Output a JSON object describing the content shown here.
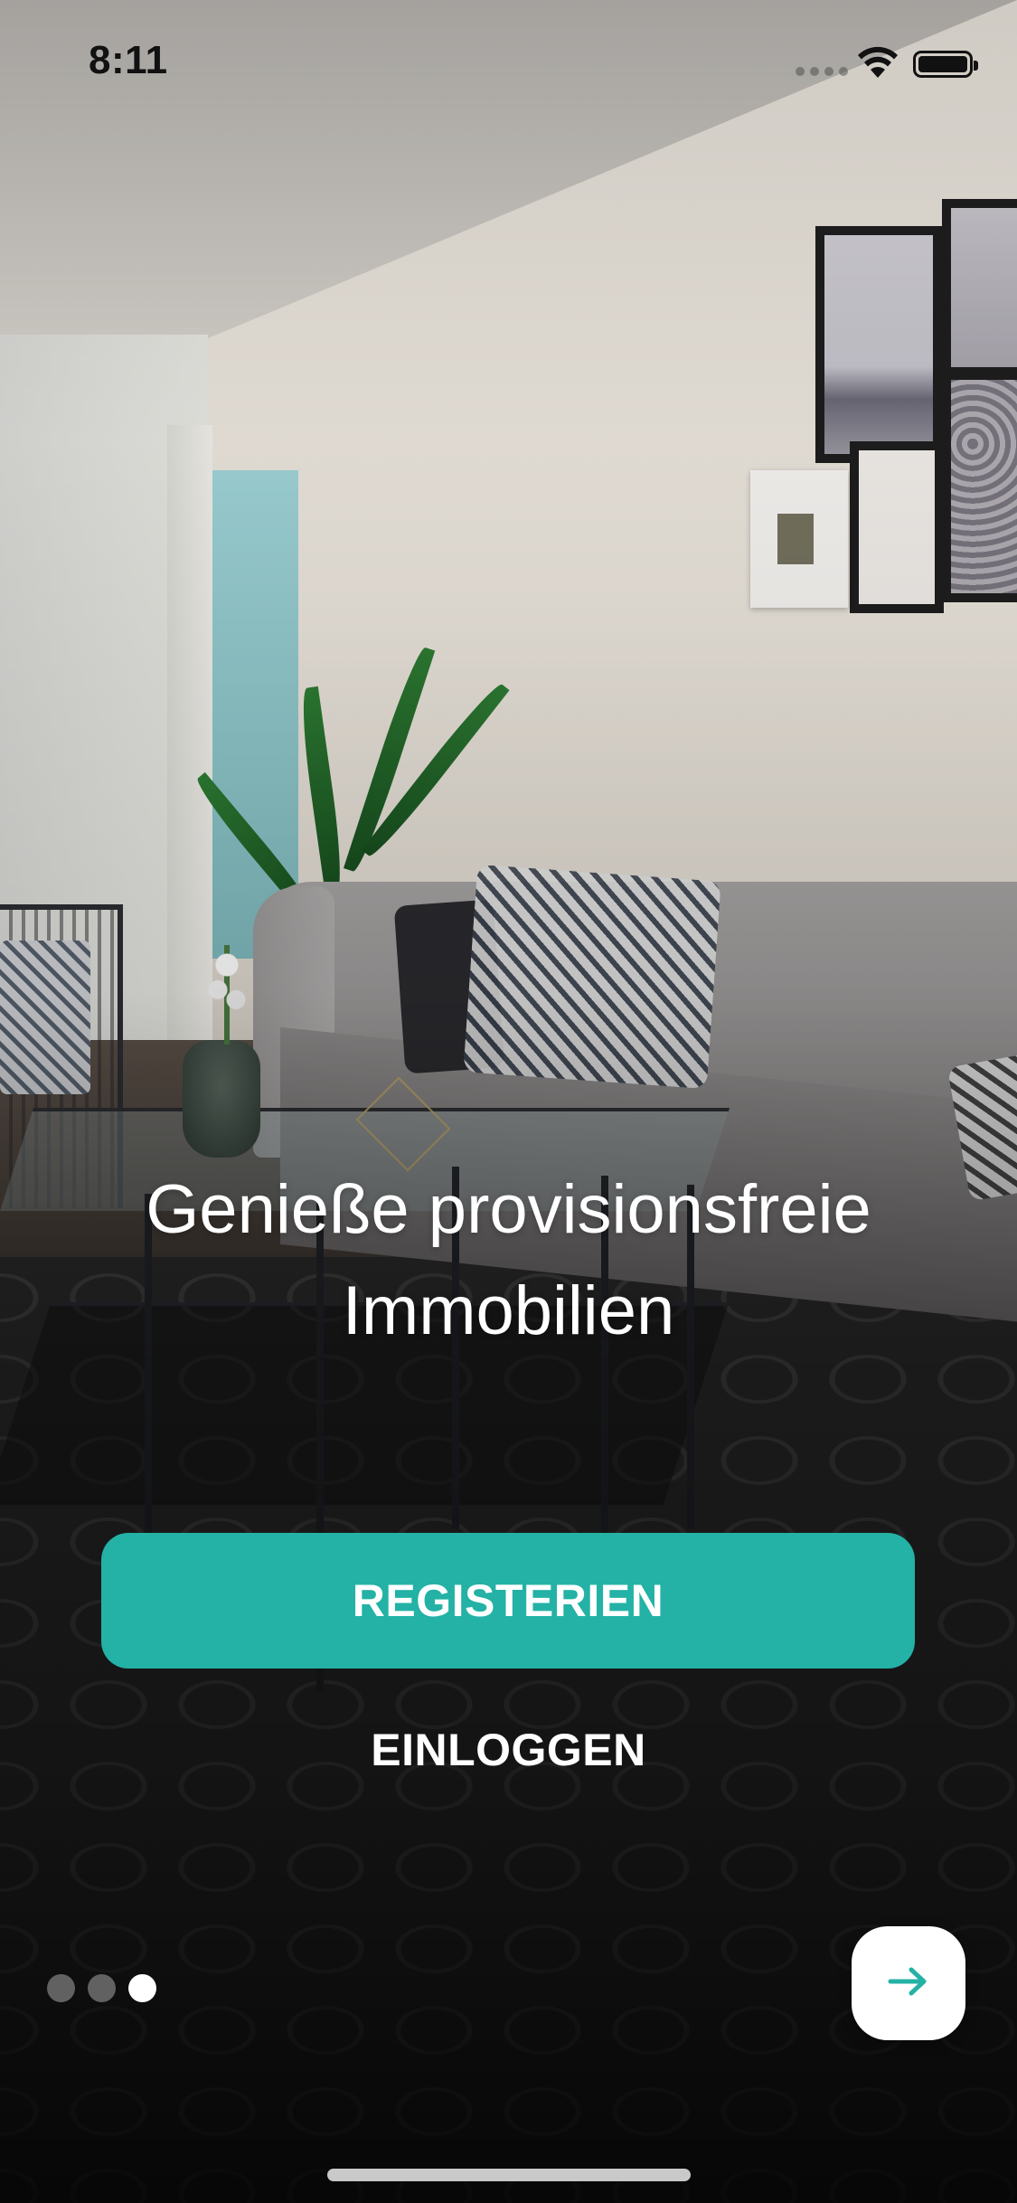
{
  "status_bar": {
    "time": "8:11"
  },
  "headline": {
    "line1": "Genieße provisionsfreie",
    "line2": "Immobilien"
  },
  "buttons": {
    "register_label": "REGISTERIEN",
    "login_label": "EINLOGGEN",
    "next_icon": "arrow-right-icon"
  },
  "pager": {
    "total": 3,
    "active_index": 2
  },
  "colors": {
    "accent": "#23b2a5",
    "text_on_dark": "#ffffff"
  }
}
